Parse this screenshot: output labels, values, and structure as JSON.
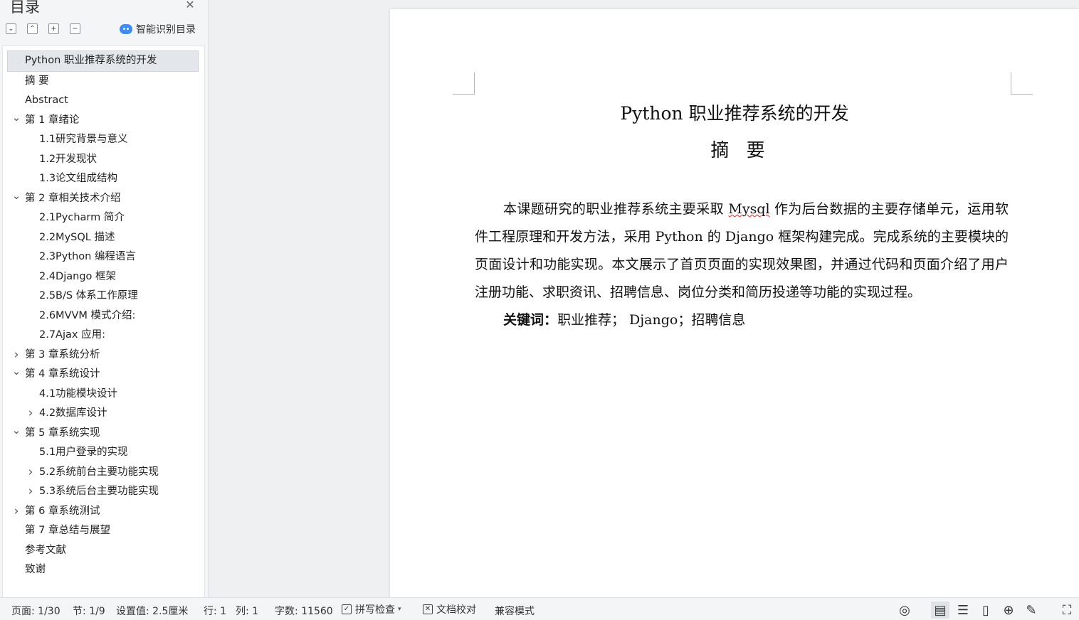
{
  "sidebar": {
    "title": "目录",
    "close_icon": "close-icon",
    "toolbar": {
      "expand_icon": "expand-all-icon",
      "collapse_icon": "collapse-all-icon",
      "add_icon": "plus-icon",
      "remove_icon": "minus-icon",
      "smart_toc_label": "智能识别目录"
    },
    "toc": [
      {
        "label": "Python 职业推荐系统的开发",
        "level": 0,
        "chevron": "none",
        "selected": true
      },
      {
        "label": "摘  要",
        "level": 0,
        "chevron": "none"
      },
      {
        "label": "Abstract",
        "level": 0,
        "chevron": "none"
      },
      {
        "label": "第 1 章绪论",
        "level": 0,
        "chevron": "down"
      },
      {
        "label": "1.1研究背景与意义",
        "level": 1,
        "chevron": "none"
      },
      {
        "label": "1.2开发现状",
        "level": 1,
        "chevron": "none"
      },
      {
        "label": "1.3论文组成结构",
        "level": 1,
        "chevron": "none"
      },
      {
        "label": "第 2 章相关技术介绍",
        "level": 0,
        "chevron": "down"
      },
      {
        "label": "2.1Pycharm 简介",
        "level": 1,
        "chevron": "none"
      },
      {
        "label": "2.2MySQL 描述",
        "level": 1,
        "chevron": "none"
      },
      {
        "label": "2.3Python 编程语言",
        "level": 1,
        "chevron": "none"
      },
      {
        "label": "2.4Django 框架",
        "level": 1,
        "chevron": "none"
      },
      {
        "label": "2.5B/S 体系工作原理",
        "level": 1,
        "chevron": "none"
      },
      {
        "label": "2.6MVVM 模式介绍:",
        "level": 1,
        "chevron": "none"
      },
      {
        "label": "2.7Ajax  应用:",
        "level": 1,
        "chevron": "none"
      },
      {
        "label": "第 3 章系统分析",
        "level": 0,
        "chevron": "right"
      },
      {
        "label": "第 4 章系统设计",
        "level": 0,
        "chevron": "down"
      },
      {
        "label": "4.1功能模块设计",
        "level": 1,
        "chevron": "none"
      },
      {
        "label": "4.2数据库设计",
        "level": 1,
        "chevron": "right"
      },
      {
        "label": "第 5 章系统实现",
        "level": 0,
        "chevron": "down"
      },
      {
        "label": "5.1用户登录的实现",
        "level": 1,
        "chevron": "none"
      },
      {
        "label": "5.2系统前台主要功能实现",
        "level": 1,
        "chevron": "right"
      },
      {
        "label": "5.3系统后台主要功能实现",
        "level": 1,
        "chevron": "right"
      },
      {
        "label": "第 6 章系统测试",
        "level": 0,
        "chevron": "right"
      },
      {
        "label": "第 7 章总结与展望",
        "level": 0,
        "chevron": "none"
      },
      {
        "label": "参考文献",
        "level": 0,
        "chevron": "none"
      },
      {
        "label": "致谢",
        "level": 0,
        "chevron": "none"
      }
    ]
  },
  "document": {
    "title": "Python 职业推荐系统的开发",
    "abstract_heading": "摘 要",
    "paragraph": {
      "part1": "本课题研究的职业推荐系统主要采取 ",
      "spell_word": "Mysql",
      "part2": " 作为后台数据的主要存储单元，运用软件工程原理和开发方法，采用 Python 的 Django 框架构建完成。完成系统的主要模块的页面设计和功能实现。本文展示了首页页面的实现效果图，并通过代码和页面介绍了用户注册功能、求职资讯、招聘信息、岗位分类和简历投递等功能的实现过程。"
    },
    "keywords_label": "关键词：",
    "keywords": "职业推荐； Django；招聘信息"
  },
  "statusbar": {
    "page": "页面: 1/30",
    "section": "节: 1/9",
    "setting": "设置值: 2.5厘米",
    "row": "行: 1",
    "col": "列: 1",
    "word_count": "字数: 11560",
    "spell_check": "拼写检查",
    "doc_proof": "文档校对",
    "compat_mode": "兼容模式"
  }
}
